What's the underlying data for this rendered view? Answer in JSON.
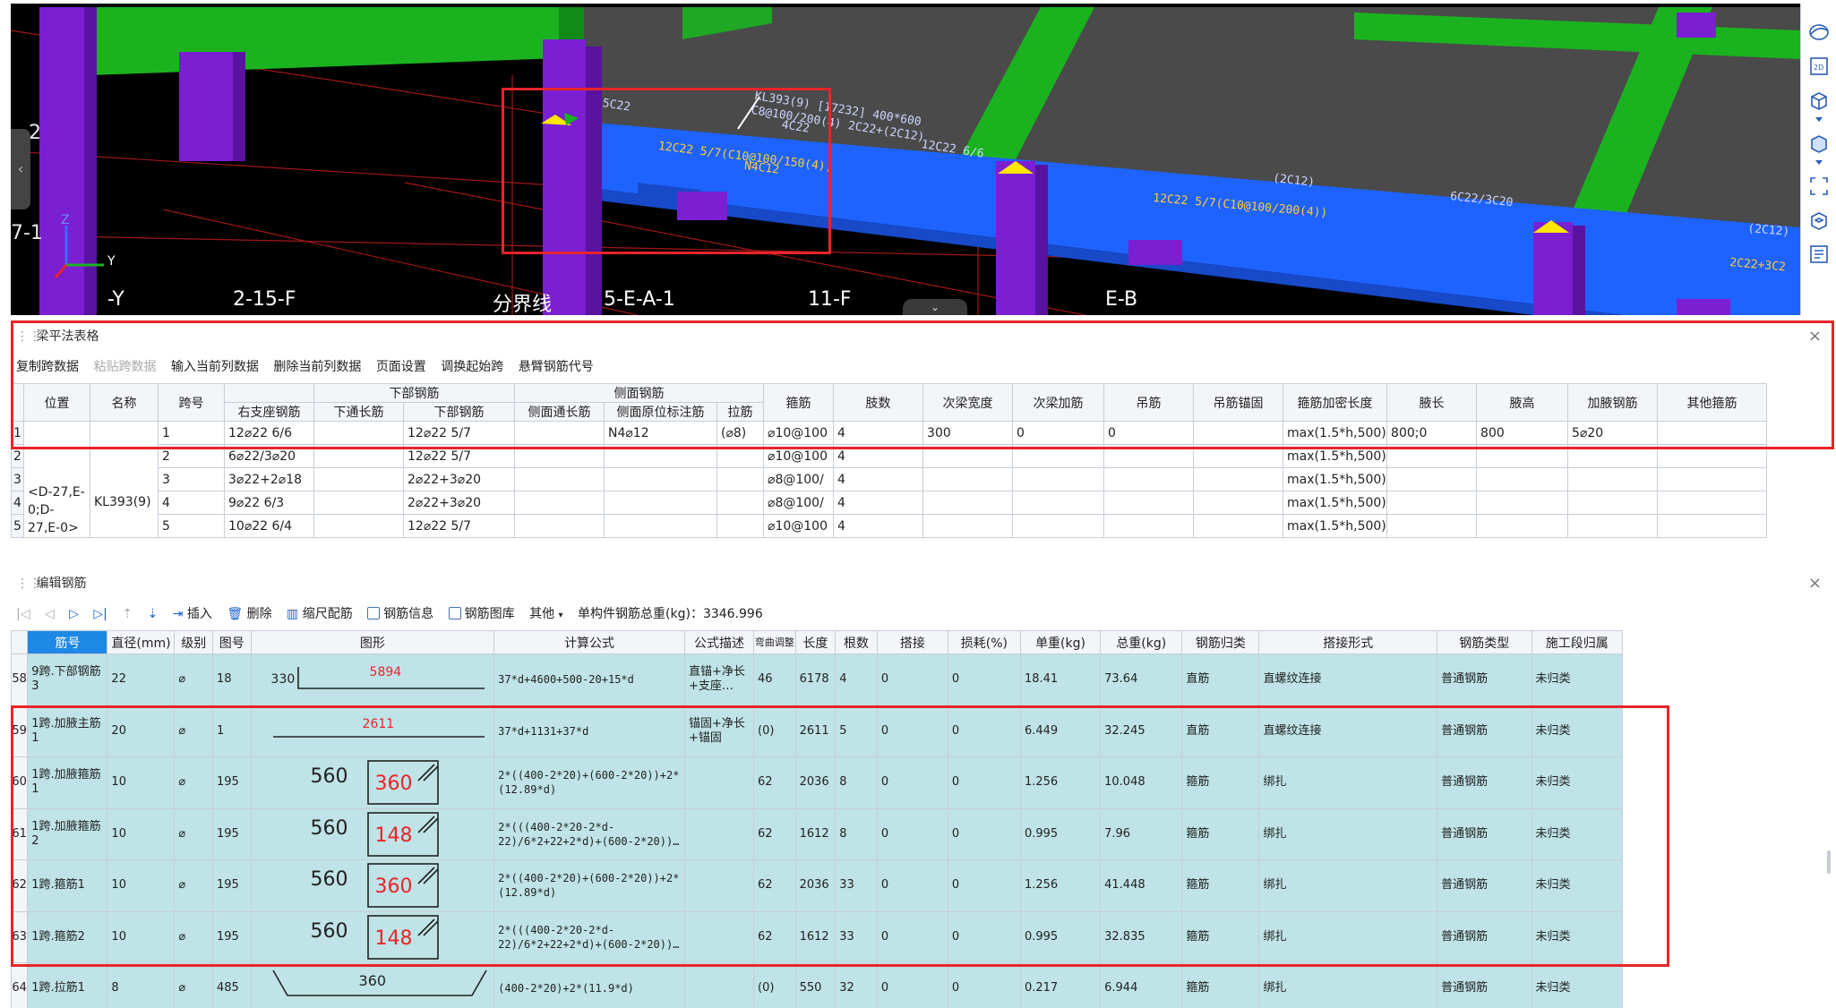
{
  "viewport": {
    "grid_tags": [
      "-Y",
      "2-15-F",
      "分界线",
      "5-E-A-1",
      "11-F",
      "E-B"
    ],
    "left_labels": [
      "2",
      "7-1"
    ],
    "axis_labels": {
      "z": "Z",
      "y": "Y"
    },
    "beam_annotations": [
      "KL393(9) [17232] 400*600",
      "C8@100/200(4) 2C22+(2C12)",
      "4C22",
      "12C22 6/6",
      "5C22",
      "12C22 5/7(C10@100/150(4))",
      "N4C12",
      "(2C12)",
      "6C22/3C20",
      "12C22 5/7(C10@100/200(4))",
      "(2C12)",
      "2C22+3C2"
    ],
    "collapse_icon": "chevron-down-icon",
    "side_tools": [
      "orbit-icon",
      "2d-icon",
      "cube-icon",
      "chevron-down-icon",
      "cube-solid-icon",
      "chevron-down-icon",
      "fullscreen-icon",
      "layers-cube-icon",
      "list-icon"
    ]
  },
  "beam_panel": {
    "title": "梁平法表格",
    "toolbar": [
      "复制跨数据",
      "粘贴跨数据",
      "输入当前列数据",
      "删除当前列数据",
      "页面设置",
      "调换起始跨",
      "悬臂钢筋代号"
    ],
    "group_headers": {
      "lower": "下部钢筋",
      "side": "侧面钢筋"
    },
    "headers": [
      "位置",
      "名称",
      "跨号",
      "右支座钢筋",
      "下通长筋",
      "下部钢筋",
      "侧面通长筋",
      "侧面原位标注筋",
      "拉筋",
      "箍筋",
      "肢数",
      "次梁宽度",
      "次梁加筋",
      "吊筋",
      "吊筋锚固",
      "箍筋加密长度",
      "腋长",
      "腋高",
      "加腋钢筋",
      "其他箍筋"
    ],
    "position_text": "<D-27,E-0;D-27,E-0>",
    "name_text": "KL393(9)",
    "rows": [
      {
        "n": "1",
        "span": "1",
        "right": "12⌀22 6/6",
        "lower": "12⌀22 5/7",
        "side_orig": "N4⌀12",
        "tie": "(⌀8)",
        "stirrup": "⌀10@100",
        "legs": "4",
        "sec_w": "300",
        "sec_add": "0",
        "hanger": "0",
        "dense": "max(1.5*h,500)",
        "haunch_l": "800;0",
        "haunch_h": "800",
        "haunch_bar": "5⌀20"
      },
      {
        "n": "2",
        "span": "2",
        "right": "6⌀22/3⌀20",
        "lower": "12⌀22 5/7",
        "side_orig": "",
        "tie": "",
        "stirrup": "⌀10@100",
        "legs": "4",
        "sec_w": "",
        "sec_add": "",
        "hanger": "",
        "dense": "max(1.5*h,500)",
        "haunch_l": "",
        "haunch_h": "",
        "haunch_bar": ""
      },
      {
        "n": "3",
        "span": "3",
        "right": "3⌀22+2⌀18",
        "lower": "2⌀22+3⌀20",
        "side_orig": "",
        "tie": "",
        "stirrup": "⌀8@100/",
        "legs": "4",
        "sec_w": "",
        "sec_add": "",
        "hanger": "",
        "dense": "max(1.5*h,500)",
        "haunch_l": "",
        "haunch_h": "",
        "haunch_bar": ""
      },
      {
        "n": "4",
        "span": "4",
        "right": "9⌀22 6/3",
        "lower": "2⌀22+3⌀20",
        "side_orig": "",
        "tie": "",
        "stirrup": "⌀8@100/",
        "legs": "4",
        "sec_w": "",
        "sec_add": "",
        "hanger": "",
        "dense": "max(1.5*h,500)",
        "haunch_l": "",
        "haunch_h": "",
        "haunch_bar": ""
      },
      {
        "n": "5",
        "span": "5",
        "right": "10⌀22 6/4",
        "lower": "12⌀22 5/7",
        "side_orig": "",
        "tie": "",
        "stirrup": "⌀10@100",
        "legs": "4",
        "sec_w": "",
        "sec_add": "",
        "hanger": "",
        "dense": "max(1.5*h,500)",
        "haunch_l": "",
        "haunch_h": "",
        "haunch_bar": ""
      }
    ]
  },
  "rebar_panel": {
    "title": "编辑钢筋",
    "toolbar": {
      "insert": "插入",
      "delete": "删除",
      "scale": "缩尺配筋",
      "info": "钢筋信息",
      "lib": "钢筋图库",
      "other": "其他",
      "total": "单构件钢筋总重(kg)：3346.996"
    },
    "headers": [
      "筋号",
      "直径(mm)",
      "级别",
      "图号",
      "图形",
      "计算公式",
      "公式描述",
      "弯曲调整",
      "长度",
      "根数",
      "搭接",
      "损耗(%)",
      "单重(kg)",
      "总重(kg)",
      "钢筋归类",
      "搭接形式",
      "钢筋类型",
      "施工段归属"
    ],
    "rows": [
      {
        "n": "58",
        "name": "9跨.下部钢筋3",
        "dia": "22",
        "grade": "⌀",
        "fig": "18",
        "shape": {
          "kind": "L",
          "a": "330",
          "b": "5894"
        },
        "formula": "37*d+4600+500-20+15*d",
        "desc": "直锚+净长+支座…",
        "bend": "46",
        "len": "6178",
        "count": "4",
        "lap": "0",
        "loss": "0",
        "unit": "18.41",
        "total": "73.64",
        "cls": "直筋",
        "lapform": "直螺纹连接",
        "type": "普通钢筋",
        "seg": "未归类"
      },
      {
        "n": "59",
        "name": "1跨.加腋主筋1",
        "dia": "20",
        "grade": "⌀",
        "fig": "1",
        "shape": {
          "kind": "line",
          "b": "2611"
        },
        "formula": "37*d+1131+37*d",
        "desc": "锚固+净长+锚固",
        "bend": "(0)",
        "len": "2611",
        "count": "5",
        "lap": "0",
        "loss": "0",
        "unit": "6.449",
        "total": "32.245",
        "cls": "直筋",
        "lapform": "直螺纹连接",
        "type": "普通钢筋",
        "seg": "未归类"
      },
      {
        "n": "60",
        "name": "1跨.加腋箍筋1",
        "dia": "10",
        "grade": "⌀",
        "fig": "195",
        "shape": {
          "kind": "stirrup",
          "a": "560",
          "b": "360"
        },
        "formula": "2*((400-2*20)+(600-2*20))+2*(12.89*d)",
        "desc": "",
        "bend": "62",
        "len": "2036",
        "count": "8",
        "lap": "0",
        "loss": "0",
        "unit": "1.256",
        "total": "10.048",
        "cls": "箍筋",
        "lapform": "绑扎",
        "type": "普通钢筋",
        "seg": "未归类"
      },
      {
        "n": "61",
        "name": "1跨.加腋箍筋2",
        "dia": "10",
        "grade": "⌀",
        "fig": "195",
        "shape": {
          "kind": "stirrup",
          "a": "560",
          "b": "148"
        },
        "formula": "2*(((400-2*20-2*d-22)/6*2+22+2*d)+(600-2*20))…",
        "desc": "",
        "bend": "62",
        "len": "1612",
        "count": "8",
        "lap": "0",
        "loss": "0",
        "unit": "0.995",
        "total": "7.96",
        "cls": "箍筋",
        "lapform": "绑扎",
        "type": "普通钢筋",
        "seg": "未归类"
      },
      {
        "n": "62",
        "name": "1跨.箍筋1",
        "dia": "10",
        "grade": "⌀",
        "fig": "195",
        "shape": {
          "kind": "stirrup",
          "a": "560",
          "b": "360"
        },
        "formula": "2*((400-2*20)+(600-2*20))+2*(12.89*d)",
        "desc": "",
        "bend": "62",
        "len": "2036",
        "count": "33",
        "lap": "0",
        "loss": "0",
        "unit": "1.256",
        "total": "41.448",
        "cls": "箍筋",
        "lapform": "绑扎",
        "type": "普通钢筋",
        "seg": "未归类"
      },
      {
        "n": "63",
        "name": "1跨.箍筋2",
        "dia": "10",
        "grade": "⌀",
        "fig": "195",
        "shape": {
          "kind": "stirrup",
          "a": "560",
          "b": "148"
        },
        "formula": "2*(((400-2*20-2*d-22)/6*2+22+2*d)+(600-2*20))…",
        "desc": "",
        "bend": "62",
        "len": "1612",
        "count": "33",
        "lap": "0",
        "loss": "0",
        "unit": "0.995",
        "total": "32.835",
        "cls": "箍筋",
        "lapform": "绑扎",
        "type": "普通钢筋",
        "seg": "未归类"
      },
      {
        "n": "64",
        "name": "1跨.拉筋1",
        "dia": "8",
        "grade": "⌀",
        "fig": "485",
        "shape": {
          "kind": "tie",
          "a": "360"
        },
        "formula": "(400-2*20)+2*(11.9*d)",
        "desc": "",
        "bend": "(0)",
        "len": "550",
        "count": "32",
        "lap": "0",
        "loss": "0",
        "unit": "0.217",
        "total": "6.944",
        "cls": "箍筋",
        "lapform": "绑扎",
        "type": "普通钢筋",
        "seg": "未归类"
      }
    ]
  }
}
